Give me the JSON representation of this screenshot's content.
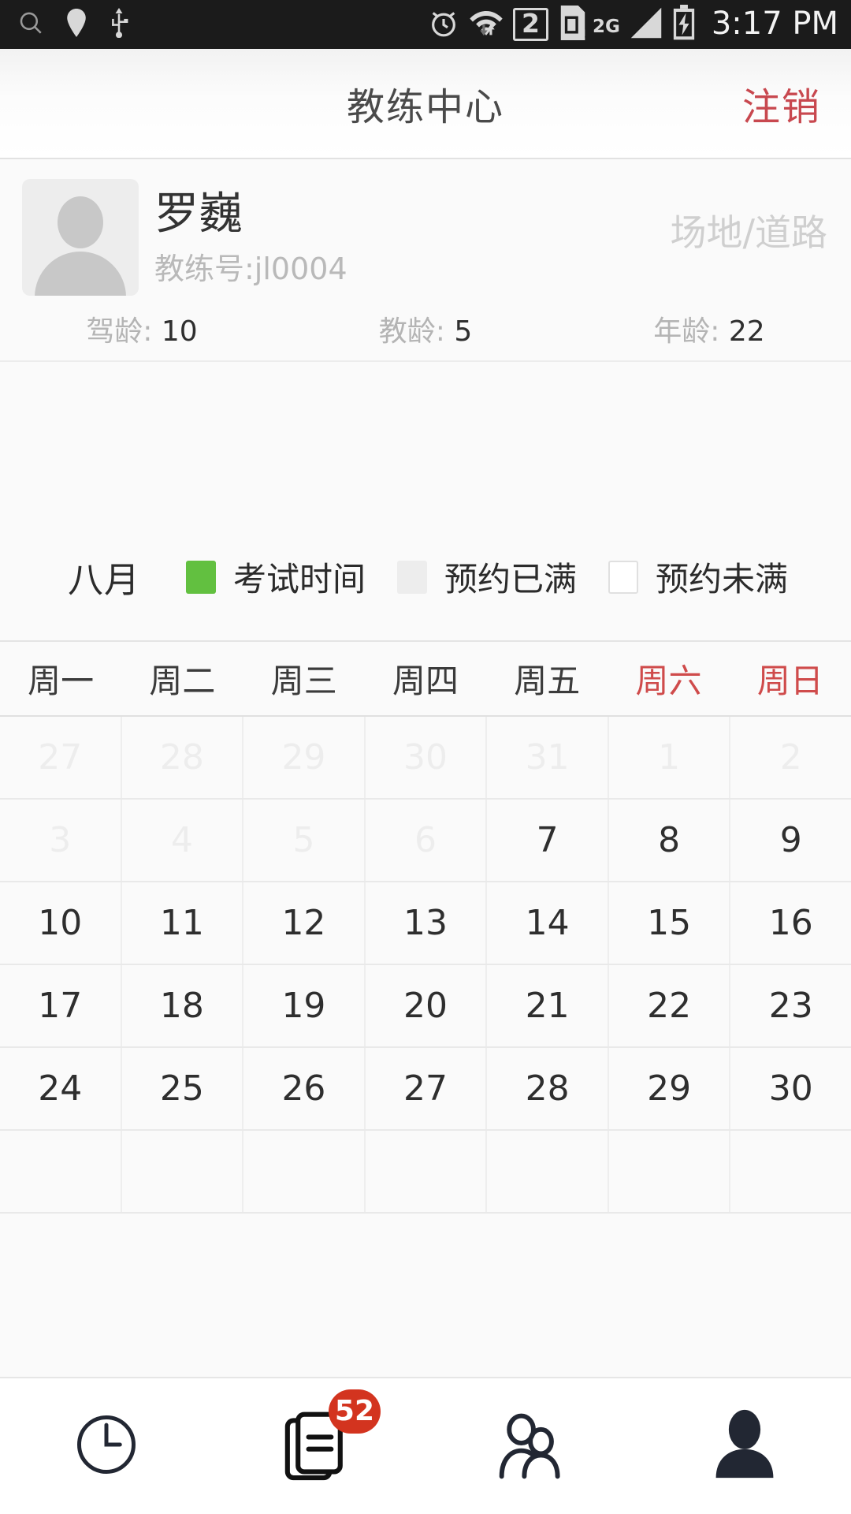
{
  "statusbar": {
    "time": "3:17 PM",
    "sim_label": "2",
    "network_label": "2G",
    "left_icons": [
      "search-icon",
      "location-pin-icon",
      "usb-icon"
    ],
    "right_icons": [
      "alarm-clock-icon",
      "wifi-icon",
      "sim-card-icon",
      "signal-bars-icon",
      "battery-charging-icon"
    ]
  },
  "header": {
    "title": "教练中心",
    "logout_label": "注销"
  },
  "profile": {
    "name": "罗巍",
    "id_label": "教练号:jl0004",
    "type_label": "场地/道路",
    "stats": [
      {
        "label": "驾龄: ",
        "value": "10"
      },
      {
        "label": "教龄: ",
        "value": "5"
      },
      {
        "label": "年龄: ",
        "value": "22"
      }
    ]
  },
  "legend": {
    "month": "八月",
    "items": [
      {
        "label": "考试时间",
        "color": "#62c040",
        "key": "exam"
      },
      {
        "label": "预约已满",
        "color": "#ededed",
        "key": "full"
      },
      {
        "label": "预约未满",
        "color": "#ffffff",
        "key": "open"
      }
    ]
  },
  "calendar": {
    "weekdays": [
      {
        "label": "周一",
        "weekend": false
      },
      {
        "label": "周二",
        "weekend": false
      },
      {
        "label": "周三",
        "weekend": false
      },
      {
        "label": "周四",
        "weekend": false
      },
      {
        "label": "周五",
        "weekend": false
      },
      {
        "label": "周六",
        "weekend": true
      },
      {
        "label": "周日",
        "weekend": true
      }
    ],
    "rows": [
      [
        {
          "day": "27",
          "muted": true
        },
        {
          "day": "28",
          "muted": true
        },
        {
          "day": "29",
          "muted": true
        },
        {
          "day": "30",
          "muted": true
        },
        {
          "day": "31",
          "muted": true
        },
        {
          "day": "1",
          "muted": true
        },
        {
          "day": "2",
          "muted": true
        }
      ],
      [
        {
          "day": "3",
          "muted": true
        },
        {
          "day": "4",
          "muted": true
        },
        {
          "day": "5",
          "muted": true
        },
        {
          "day": "6",
          "muted": true
        },
        {
          "day": "7",
          "muted": false
        },
        {
          "day": "8",
          "muted": false
        },
        {
          "day": "9",
          "muted": false
        }
      ],
      [
        {
          "day": "10",
          "muted": false
        },
        {
          "day": "11",
          "muted": false
        },
        {
          "day": "12",
          "muted": false
        },
        {
          "day": "13",
          "muted": false
        },
        {
          "day": "14",
          "muted": false
        },
        {
          "day": "15",
          "muted": false
        },
        {
          "day": "16",
          "muted": false
        }
      ],
      [
        {
          "day": "17",
          "muted": false
        },
        {
          "day": "18",
          "muted": false
        },
        {
          "day": "19",
          "muted": false
        },
        {
          "day": "20",
          "muted": false
        },
        {
          "day": "21",
          "muted": false
        },
        {
          "day": "22",
          "muted": false
        },
        {
          "day": "23",
          "muted": false
        }
      ],
      [
        {
          "day": "24",
          "muted": false
        },
        {
          "day": "25",
          "muted": false
        },
        {
          "day": "26",
          "muted": false
        },
        {
          "day": "27",
          "muted": false
        },
        {
          "day": "28",
          "muted": false
        },
        {
          "day": "29",
          "muted": false
        },
        {
          "day": "30",
          "muted": false
        }
      ],
      [
        {
          "day": "",
          "muted": false
        },
        {
          "day": "",
          "muted": false
        },
        {
          "day": "",
          "muted": false
        },
        {
          "day": "",
          "muted": false
        },
        {
          "day": "",
          "muted": false
        },
        {
          "day": "",
          "muted": false
        },
        {
          "day": "",
          "muted": false
        }
      ]
    ]
  },
  "bottom_nav": {
    "items": [
      {
        "icon": "clock-icon",
        "badge": null,
        "active": false
      },
      {
        "icon": "documents-icon",
        "badge": "52",
        "active": false
      },
      {
        "icon": "two-people-icon",
        "badge": null,
        "active": false
      },
      {
        "icon": "person-filled-icon",
        "badge": null,
        "active": true
      }
    ]
  },
  "colors": {
    "accent_red": "#c8484f",
    "badge_red": "#d3341f",
    "exam_green": "#62c040",
    "weekend_red": "#cf4b4b"
  }
}
